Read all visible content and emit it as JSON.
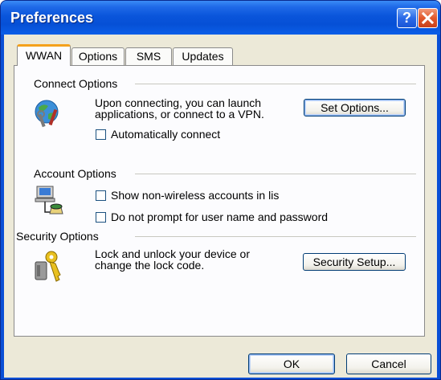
{
  "window": {
    "title": "Preferences",
    "help_button": "?",
    "close_button": "close"
  },
  "tabs": [
    {
      "label": "WWAN",
      "active": true
    },
    {
      "label": "Options",
      "active": false
    },
    {
      "label": "SMS",
      "active": false
    },
    {
      "label": "Updates",
      "active": false
    }
  ],
  "connect_options": {
    "group_label": "Connect Options",
    "description_line1": "Upon connecting, you can launch",
    "description_line2": "applications, or connect to a VPN.",
    "set_options_button": "Set Options...",
    "auto_connect": {
      "label": "Automatically connect",
      "checked": false
    },
    "icon": "network-tools-icon"
  },
  "account_options": {
    "group_label": "Account Options",
    "show_non_wireless": {
      "label": "Show non-wireless accounts in lis",
      "checked": false
    },
    "do_not_prompt": {
      "label": "Do not prompt for user name and password",
      "checked": false
    },
    "icon": "network-computers-icon"
  },
  "security_options": {
    "group_label": "Security Options",
    "description_line1": "Lock and unlock your device or",
    "description_line2": "change the lock code.",
    "security_setup_button": "Security Setup...",
    "icon": "keys-lock-icon"
  },
  "footer": {
    "ok_button": "OK",
    "cancel_button": "Cancel"
  },
  "colors": {
    "titlebar": "#0a55db",
    "dialog_face": "#ece9d8",
    "panel": "#fcfcfe",
    "active_tab_accent": "#f4a11c",
    "button_border": "#003c74"
  }
}
